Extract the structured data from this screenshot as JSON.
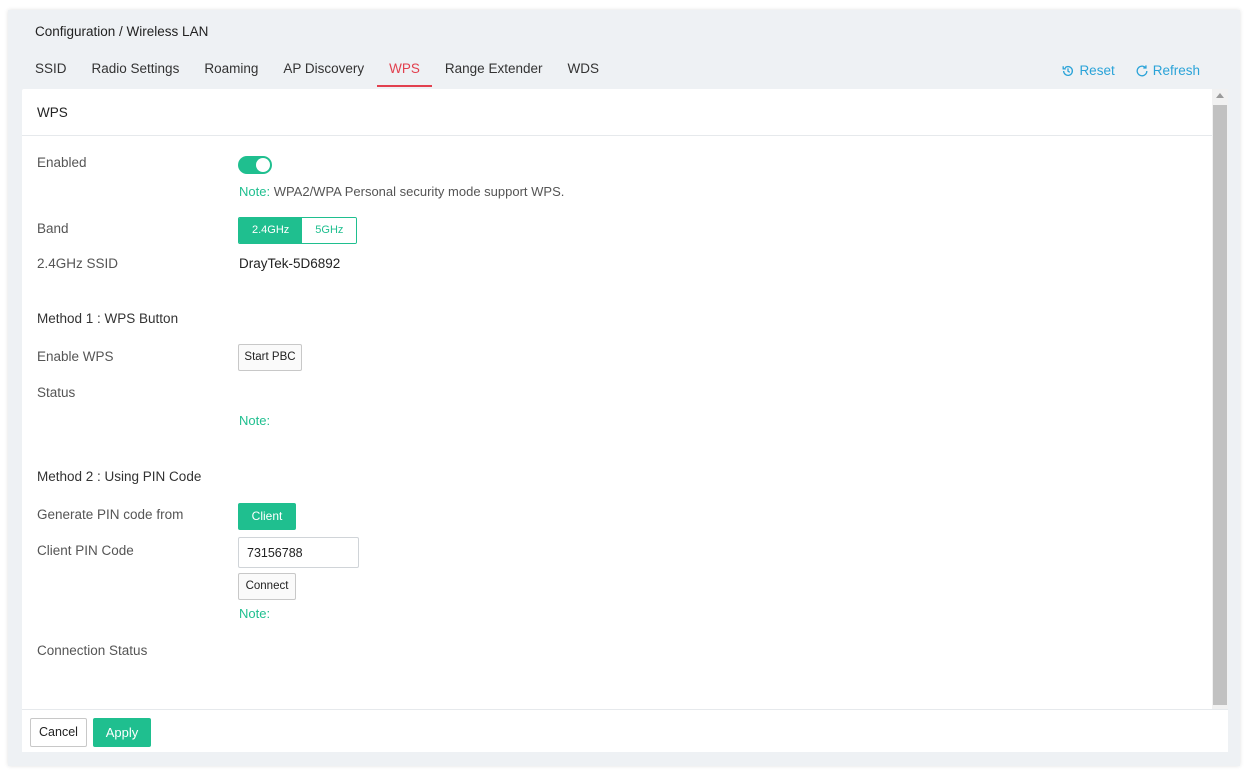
{
  "breadcrumb": "Configuration / Wireless LAN",
  "tabs": [
    {
      "label": "SSID"
    },
    {
      "label": "Radio Settings"
    },
    {
      "label": "Roaming"
    },
    {
      "label": "AP Discovery"
    },
    {
      "label": "WPS",
      "active": true
    },
    {
      "label": "Range Extender"
    },
    {
      "label": "WDS"
    }
  ],
  "actions": {
    "reset": "Reset",
    "refresh": "Refresh"
  },
  "panel": {
    "title": "WPS"
  },
  "form": {
    "enabled_label": "Enabled",
    "enabled_value": true,
    "enabled_note_key": "Note:",
    "enabled_note_text": " WPA2/WPA Personal security mode support WPS.",
    "band_label": "Band",
    "band_options": [
      "2.4GHz",
      "5GHz"
    ],
    "band_selected": "2.4GHz",
    "ssid_label": "2.4GHz SSID",
    "ssid_value": "DrayTek-5D6892",
    "method1_title": "Method 1 : WPS Button",
    "enable_wps_label": "Enable WPS",
    "start_pbc": "Start PBC",
    "status_label": "Status",
    "status_note_key": "Note:",
    "method2_title": "Method 2 : Using PIN Code",
    "generate_pin_label": "Generate PIN code from",
    "client_button": "Client",
    "client_pin_label": "Client PIN Code",
    "client_pin_value": "73156788",
    "connect_button": "Connect",
    "connect_note_key": "Note:",
    "connection_status_label": "Connection Status"
  },
  "footer": {
    "cancel": "Cancel",
    "apply": "Apply"
  },
  "colors": {
    "accent": "#1fbf8f",
    "active_tab": "#e2404e",
    "link": "#2aa3d8"
  }
}
